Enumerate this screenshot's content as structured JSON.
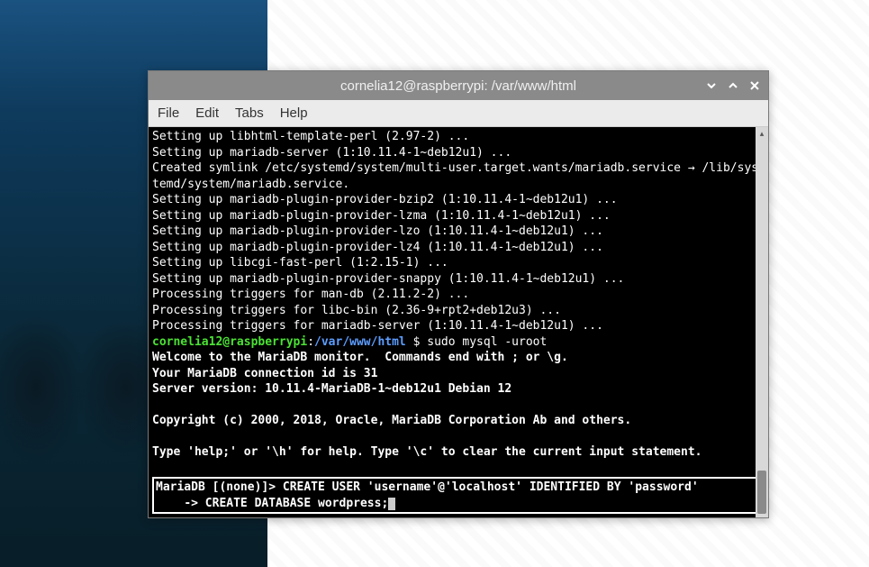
{
  "window": {
    "title": "cornelia12@raspberrypi: /var/www/html"
  },
  "menubar": {
    "items": [
      "File",
      "Edit",
      "Tabs",
      "Help"
    ]
  },
  "terminal": {
    "lines": [
      "Setting up libhtml-template-perl (2.97-2) ...",
      "Setting up mariadb-server (1:10.11.4-1~deb12u1) ...",
      "Created symlink /etc/systemd/system/multi-user.target.wants/mariadb.service → /lib/systemd/system/mariadb.service.",
      "Setting up mariadb-plugin-provider-bzip2 (1:10.11.4-1~deb12u1) ...",
      "Setting up mariadb-plugin-provider-lzma (1:10.11.4-1~deb12u1) ...",
      "Setting up mariadb-plugin-provider-lzo (1:10.11.4-1~deb12u1) ...",
      "Setting up mariadb-plugin-provider-lz4 (1:10.11.4-1~deb12u1) ...",
      "Setting up libcgi-fast-perl (1:2.15-1) ...",
      "Setting up mariadb-plugin-provider-snappy (1:10.11.4-1~deb12u1) ...",
      "Processing triggers for man-db (2.11.2-2) ...",
      "Processing triggers for libc-bin (2.36-9+rpt2+deb12u3) ...",
      "Processing triggers for mariadb-server (1:10.11.4-1~deb12u1) ..."
    ],
    "prompt": {
      "user": "cornelia12@raspberrypi",
      "sep": ":",
      "path": "/var/www/html",
      "sigil": " $ ",
      "command": "sudo mysql -uroot"
    },
    "bold_lines": [
      "Welcome to the MariaDB monitor.  Commands end with ; or \\g.",
      "Your MariaDB connection id is 31",
      "Server version: 10.11.4-MariaDB-1~deb12u1 Debian 12",
      "",
      "Copyright (c) 2000, 2018, Oracle, MariaDB Corporation Ab and others.",
      "",
      "Type 'help;' or '\\h' for help. Type '\\c' to clear the current input statement.",
      ""
    ],
    "highlighted": [
      "MariaDB [(none)]> CREATE USER 'username'@'localhost' IDENTIFIED BY 'password'",
      "    -> CREATE DATABASE wordpress;"
    ]
  }
}
